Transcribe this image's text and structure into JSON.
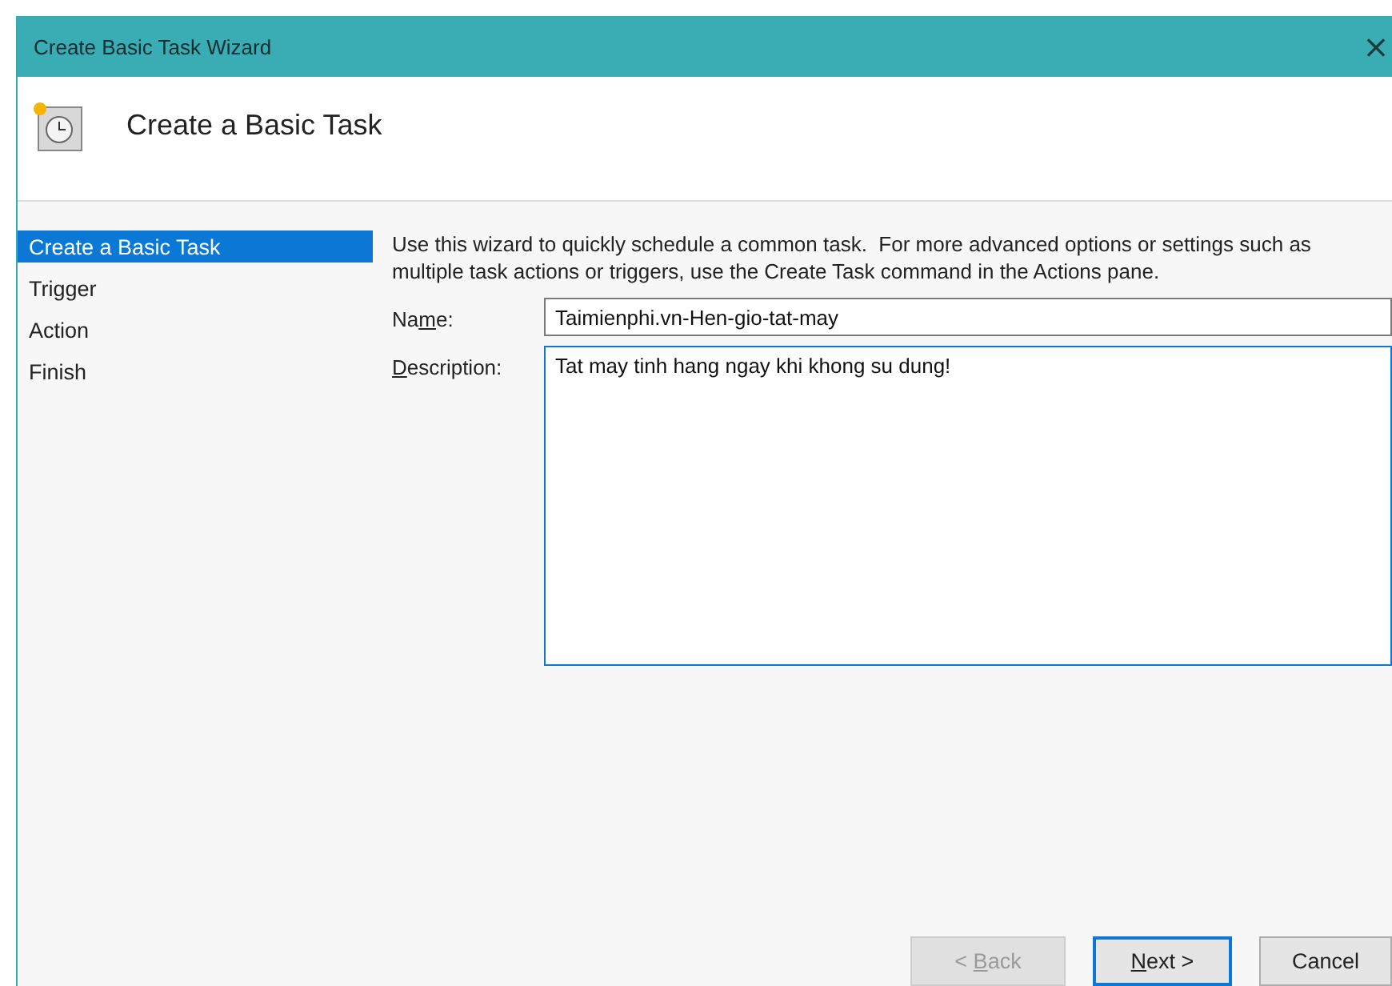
{
  "window": {
    "title": "Create Basic Task Wizard",
    "close": "×"
  },
  "header": {
    "title": "Create a Basic Task"
  },
  "steps": [
    {
      "label": "Create a Basic Task",
      "selected": true
    },
    {
      "label": "Trigger",
      "selected": false
    },
    {
      "label": "Action",
      "selected": false
    },
    {
      "label": "Finish",
      "selected": false
    }
  ],
  "intro": "Use this wizard to quickly schedule a common task.  For more advanced options or settings such as multiple task actions or triggers, use the Create Task command in the Actions pane.",
  "name_field": {
    "label": {
      "before": "Na",
      "key": "m",
      "after": "e:"
    },
    "value": "Taimienphi.vn-Hen-gio-tat-may"
  },
  "description_field": {
    "label": {
      "key": "D",
      "after": "escription:"
    },
    "value": "Tat may tinh hang ngay khi khong su dung!"
  },
  "buttons": [
    {
      "label": {
        "before": "< ",
        "key": "B",
        "after": "ack"
      },
      "disabled": true,
      "default": false
    },
    {
      "label": {
        "key": "N",
        "after": "ext >"
      },
      "disabled": false,
      "default": true
    },
    {
      "label": {
        "before": "Cancel"
      },
      "disabled": false,
      "default": false
    }
  ]
}
